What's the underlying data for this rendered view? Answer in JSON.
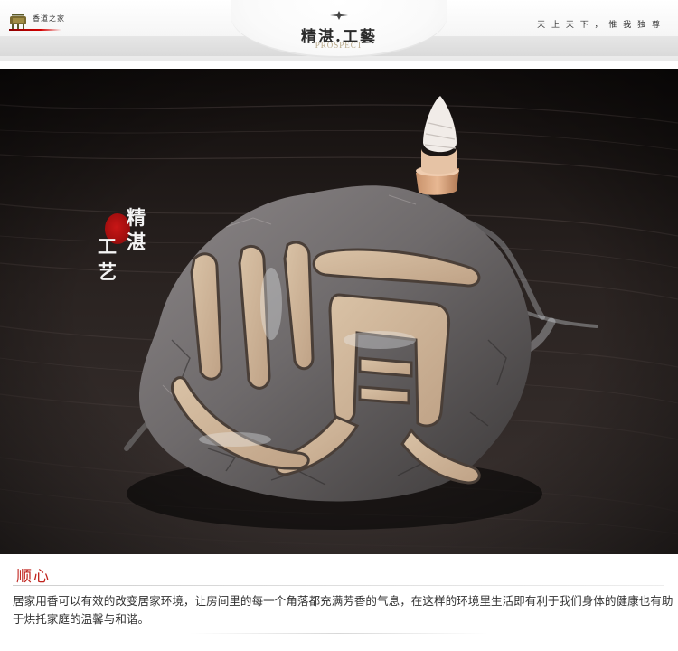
{
  "header": {
    "brand": "香道之家",
    "slogan": "天 上 天 下 ， 惟 我 独 尊",
    "title": "精湛.工藝",
    "subtitle": "PROSPECT",
    "logo_icon": "incense-burner-icon"
  },
  "photo": {
    "callout_chars": [
      "精",
      "湛",
      "工",
      "艺"
    ],
    "seal_color": "#b01010"
  },
  "section": {
    "title": "顺心",
    "description": "居家用香可以有效的改变居家环境，让房间里的每一个角落都充满芳香的气息，在这样的环境里生活即有利于我们身体的健康也有助于烘托家庭的温馨与和谐。"
  },
  "colors": {
    "accent_red": "#c0231d",
    "header_gray": "#e6e6e6"
  }
}
